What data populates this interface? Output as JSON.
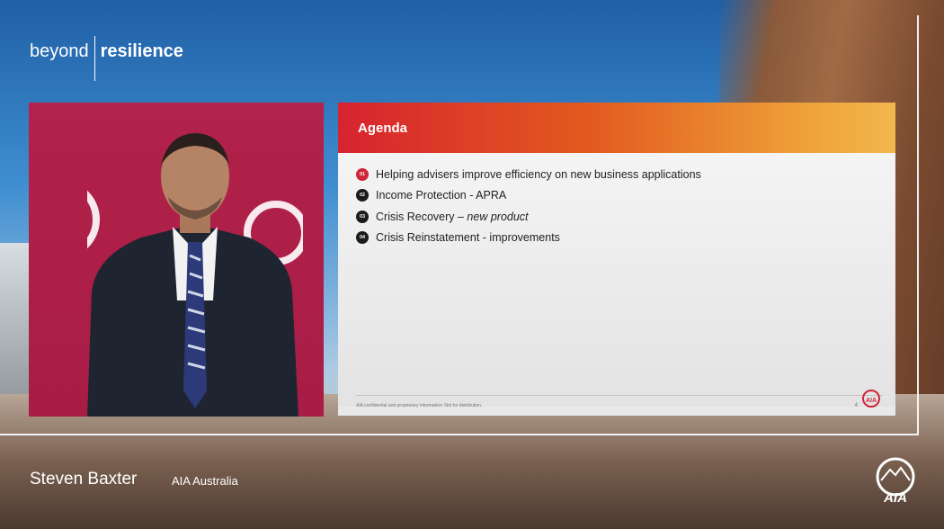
{
  "brand": {
    "word1": "beyond",
    "word2": "resilience"
  },
  "slide": {
    "title": "Agenda",
    "items": [
      {
        "num": "01",
        "text": "Helping advisers improve efficiency on new business applications",
        "emph": ""
      },
      {
        "num": "02",
        "text": "Income Protection - APRA",
        "emph": ""
      },
      {
        "num": "03",
        "text": "Crisis Recovery – ",
        "emph": "new product"
      },
      {
        "num": "04",
        "text": "Crisis Reinstatement - improvements",
        "emph": ""
      }
    ],
    "footer_note": "AIA confidential and proprietary information. Not for distribution.",
    "page": "4",
    "logo_text": "AIA"
  },
  "caption": {
    "name": "Steven Baxter",
    "org": "AIA Australia"
  },
  "logo": {
    "text": "AIA"
  },
  "colors": {
    "accent_red": "#d0253a",
    "header_orange": "#efa33a",
    "video_bg": "#b2224a"
  }
}
